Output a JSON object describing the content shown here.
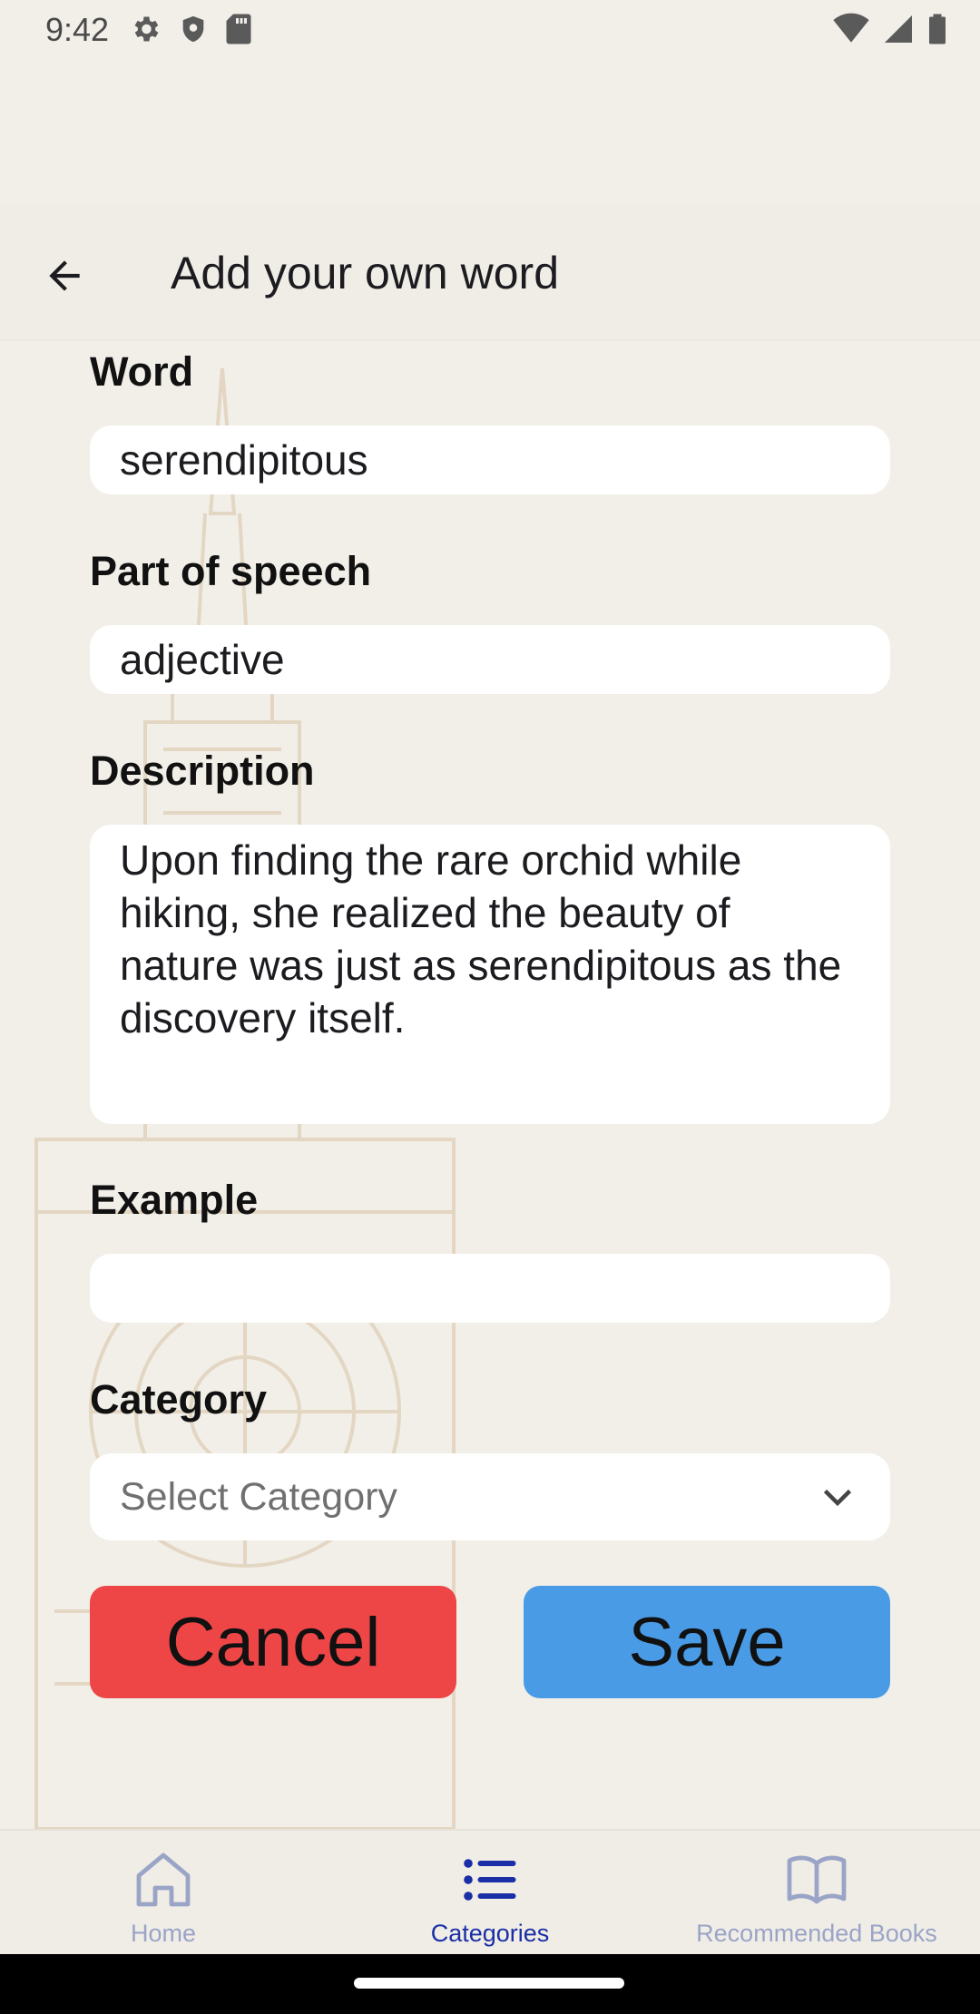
{
  "status_bar": {
    "time": "9:42",
    "left_icons": [
      "gear-icon",
      "shield-icon",
      "sd-card-icon"
    ],
    "right_icons": [
      "wifi-icon",
      "signal-icon",
      "battery-icon"
    ]
  },
  "toolbar": {
    "back_icon": "arrow-left-icon",
    "title": "Add your own word"
  },
  "form": {
    "word": {
      "label": "Word",
      "value": "serendipitous"
    },
    "part_of_speech": {
      "label": "Part of speech",
      "value": "adjective"
    },
    "description": {
      "label": "Description",
      "value": "Upon finding the rare orchid while hiking, she realized the beauty of nature was just as serendipitous as the discovery itself."
    },
    "example": {
      "label": "Example",
      "value": ""
    },
    "category": {
      "label": "Category",
      "placeholder": "Select Category",
      "chevron_icon": "chevron-down-icon"
    },
    "cancel_label": "Cancel",
    "save_label": "Save"
  },
  "colors": {
    "background": "#f2efe9",
    "cancel": "#ee4646",
    "save": "#4a9be6",
    "nav_active": "#1a2ea6",
    "nav_inactive": "#9aa4c6"
  },
  "bottom_nav": {
    "items": [
      {
        "label": "Home",
        "icon": "home-icon",
        "active": false
      },
      {
        "label": "Categories",
        "icon": "list-icon",
        "active": true
      },
      {
        "label": "Recommended Books",
        "icon": "book-icon",
        "active": false
      }
    ]
  }
}
